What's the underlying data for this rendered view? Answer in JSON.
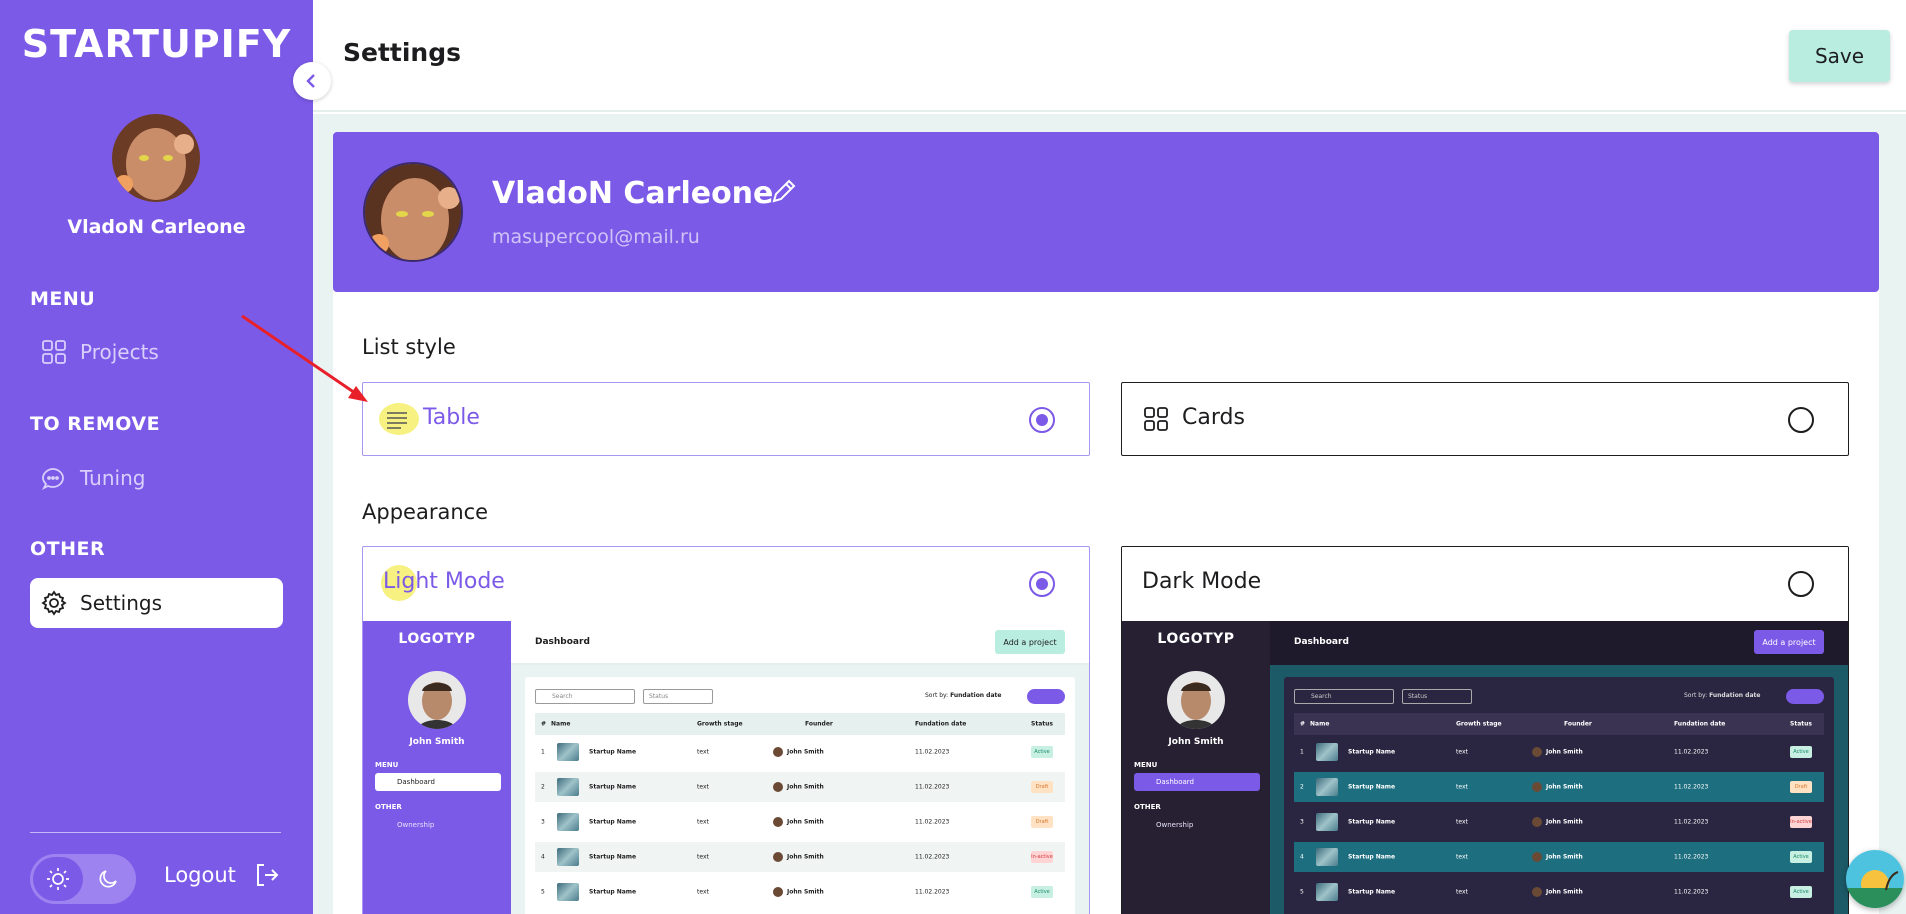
{
  "sidebar": {
    "brand": "STARTUPIFY",
    "user_name": "VladoN Carleone",
    "menu_title": "MENU",
    "menu_items": [
      {
        "label": "Projects",
        "icon": "grid-icon"
      }
    ],
    "remove_title": "TO REMOVE",
    "remove_items": [
      {
        "label": "Tuning",
        "icon": "chat-bubbles-icon"
      }
    ],
    "other_title": "OTHER",
    "other_items": [
      {
        "label": "Settings",
        "icon": "gear-icon",
        "active": true
      }
    ],
    "logout_label": "Logout",
    "theme": {
      "light_icon": "sun-icon",
      "dark_icon": "moon-icon",
      "selected": "light"
    }
  },
  "header": {
    "title": "Settings",
    "save_label": "Save"
  },
  "profile": {
    "name": "VladoN Carleone",
    "email": "masupercool@mail.ru"
  },
  "list_style": {
    "label": "List style",
    "options": [
      {
        "label": "Table",
        "icon": "list-icon",
        "selected": true
      },
      {
        "label": "Cards",
        "icon": "grid-icon",
        "selected": false
      }
    ]
  },
  "appearance": {
    "label": "Appearance",
    "options": [
      {
        "label": "Light Mode",
        "selected": true
      },
      {
        "label": "Dark Mode",
        "selected": false
      }
    ]
  },
  "preview": {
    "logo": "LOGOTYP",
    "user": "John Smith",
    "menu": "MENU",
    "dashboard": "Dashboard",
    "other": "OTHER",
    "ownership": "Ownership",
    "title": "Dashboard",
    "add_button": "Add a project",
    "search_placeholder": "Search",
    "status_placeholder": "Status",
    "sort_label": "Sort by:",
    "sort_value": "Fundation date",
    "columns": [
      "#",
      "Name",
      "Growth stage",
      "Founder",
      "Fundation date",
      "Status"
    ],
    "rows_light": [
      {
        "n": "1",
        "name": "Startup Name",
        "stage": "text",
        "founder": "John Smith",
        "date": "11.02.2023",
        "status": "Active"
      },
      {
        "n": "2",
        "name": "Startup Name",
        "stage": "text",
        "founder": "John Smith",
        "date": "11.02.2023",
        "status": "Draft"
      },
      {
        "n": "3",
        "name": "Startup Name",
        "stage": "text",
        "founder": "John Smith",
        "date": "11.02.2023",
        "status": "Draft"
      },
      {
        "n": "4",
        "name": "Startup Name",
        "stage": "text",
        "founder": "John Smith",
        "date": "11.02.2023",
        "status": "In-active"
      },
      {
        "n": "5",
        "name": "Startup Name",
        "stage": "text",
        "founder": "John Smith",
        "date": "11.02.2023",
        "status": "Active"
      }
    ],
    "rows_dark": [
      {
        "n": "1",
        "name": "Startup Name",
        "stage": "text",
        "founder": "John Smith",
        "date": "11.02.2023",
        "status": "Active"
      },
      {
        "n": "2",
        "name": "Startup Name",
        "stage": "text",
        "founder": "John Smith",
        "date": "11.02.2023",
        "status": "Draft"
      },
      {
        "n": "3",
        "name": "Startup Name",
        "stage": "text",
        "founder": "John Smith",
        "date": "11.02.2023",
        "status": "In-active"
      },
      {
        "n": "4",
        "name": "Startup Name",
        "stage": "text",
        "founder": "John Smith",
        "date": "11.02.2023",
        "status": "Active"
      },
      {
        "n": "5",
        "name": "Startup Name",
        "stage": "text",
        "founder": "John Smith",
        "date": "11.02.2023",
        "status": "Active"
      }
    ]
  },
  "colors": {
    "accent": "#7c5ae8",
    "save_bg": "#b9ede0",
    "main_bg": "#e9f3f1",
    "annotation": "#e8202a"
  }
}
